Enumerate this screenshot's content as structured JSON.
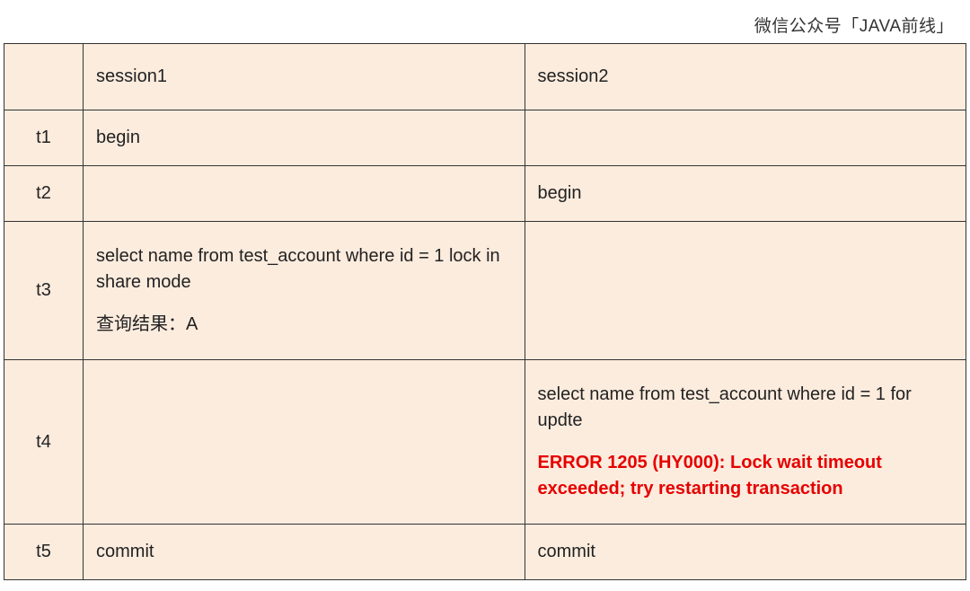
{
  "attribution": "微信公众号「JAVA前线」",
  "headers": {
    "time": "",
    "session1": "session1",
    "session2": "session2"
  },
  "rows": [
    {
      "time": "t1",
      "s1": {
        "text": "begin"
      },
      "s2": {
        "text": ""
      }
    },
    {
      "time": "t2",
      "s1": {
        "text": ""
      },
      "s2": {
        "text": "begin"
      }
    },
    {
      "time": "t3",
      "s1": {
        "text": "select name from test_account where id = 1 lock in share mode",
        "result": "查询结果：A"
      },
      "s2": {
        "text": ""
      }
    },
    {
      "time": "t4",
      "s1": {
        "text": ""
      },
      "s2": {
        "text": "select name from test_account where id = 1 for updte",
        "error": "ERROR 1205 (HY000): Lock wait timeout exceeded; try restarting transaction"
      }
    },
    {
      "time": "t5",
      "s1": {
        "text": "commit"
      },
      "s2": {
        "text": "commit"
      }
    }
  ]
}
